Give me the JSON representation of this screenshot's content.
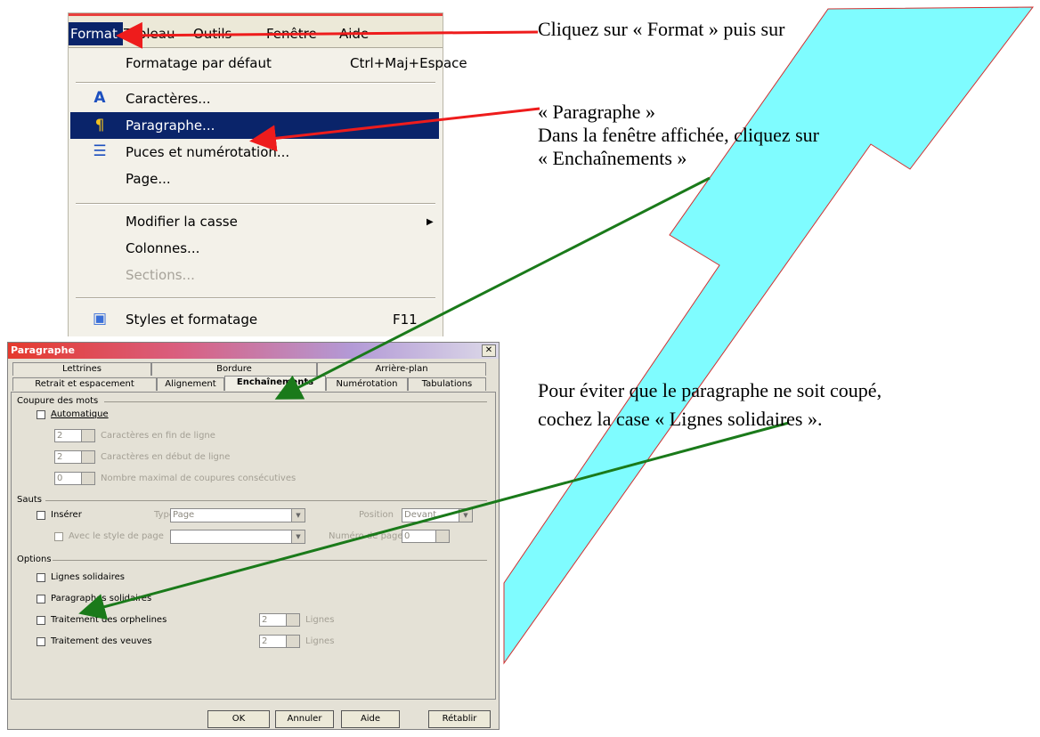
{
  "menubar": {
    "items": [
      "Format",
      "Tableau",
      "Outils",
      "Fenêtre",
      "Aide"
    ]
  },
  "menu": {
    "items": [
      {
        "label": "Formatage par défaut",
        "shortcut": "Ctrl+Maj+Espace",
        "icon": "",
        "state": "normal"
      },
      {
        "label": "Caractères...",
        "shortcut": "",
        "icon": "font-icon",
        "state": "normal"
      },
      {
        "label": "Paragraphe...",
        "shortcut": "",
        "icon": "paragraph-icon",
        "state": "selected"
      },
      {
        "label": "Puces et numérotation...",
        "shortcut": "",
        "icon": "bullets-icon",
        "state": "normal"
      },
      {
        "label": "Page...",
        "shortcut": "",
        "icon": "",
        "state": "normal"
      },
      {
        "label": "Modifier la casse",
        "shortcut": "",
        "icon": "",
        "state": "submenu"
      },
      {
        "label": "Colonnes...",
        "shortcut": "",
        "icon": "",
        "state": "normal"
      },
      {
        "label": "Sections...",
        "shortcut": "",
        "icon": "",
        "state": "disabled"
      },
      {
        "label": "Styles et formatage",
        "shortcut": "F11",
        "icon": "styles-icon",
        "state": "normal"
      }
    ]
  },
  "dialog": {
    "title": "Paragraphe",
    "close": "✕",
    "tabs_back": [
      "Lettrines",
      "Bordure",
      "Arrière-plan"
    ],
    "tabs_front": [
      "Retrait et espacement",
      "Alignement",
      "Enchaînements",
      "Numérotation",
      "Tabulations"
    ],
    "active_tab": "Enchaînements",
    "hyphenation": {
      "group": "Coupure des mots",
      "auto_label": "Automatique",
      "fields": [
        {
          "value": "2",
          "label": "Caractères en fin de ligne"
        },
        {
          "value": "2",
          "label": "Caractères en début de ligne"
        },
        {
          "value": "0",
          "label": "Nombre maximal de coupures consécutives"
        }
      ]
    },
    "breaks": {
      "group": "Sauts",
      "insert_label": "Insérer",
      "type_label": "Type",
      "type_value": "Page",
      "position_label": "Position",
      "position_value": "Devant",
      "style_label": "Avec le style de page",
      "style_value": "",
      "page_number_label": "Numéro de page",
      "page_number_value": "0"
    },
    "options": {
      "group": "Options",
      "keep_lines": "Lignes solidaires",
      "keep_next": "Paragraphes solidaires",
      "orphans": "Traitement des orphelines",
      "orphans_value": "2",
      "widows": "Traitement des veuves",
      "widows_value": "2",
      "lines_unit": "Lignes"
    },
    "buttons": [
      "OK",
      "Annuler",
      "Aide",
      "Rétablir"
    ]
  },
  "notes": {
    "line1": "Cliquez sur « Format » puis sur",
    "line2": "« Paragraphe »",
    "line3": "Dans la fenêtre affichée, cliquez sur",
    "line4": "« Enchaînements »",
    "line5": "Pour éviter que le paragraphe ne soit coupé,",
    "line6": "cochez la case « Lignes solidaires »."
  },
  "colors": {
    "arrow_red": "#ee1c1c",
    "arrow_green": "#1a7a1a",
    "cyan_arrow": "#7ffcff",
    "menu_highlight": "#0a246a"
  }
}
